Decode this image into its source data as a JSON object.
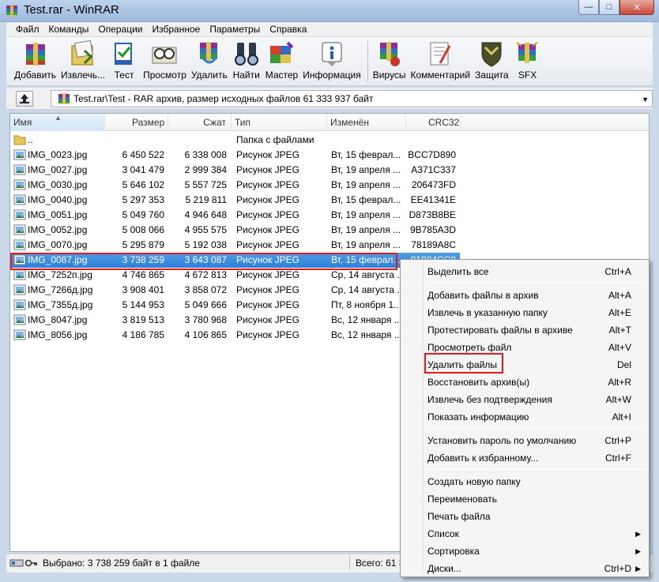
{
  "window": {
    "title": "Test.rar - WinRAR"
  },
  "menu": [
    "Файл",
    "Команды",
    "Операции",
    "Избранное",
    "Параметры",
    "Справка"
  ],
  "toolbar": [
    {
      "label": "Добавить",
      "icon": "add-archive-icon"
    },
    {
      "label": "Извлечь...",
      "icon": "extract-icon"
    },
    {
      "label": "Тест",
      "icon": "test-icon"
    },
    {
      "label": "Просмотр",
      "icon": "view-icon"
    },
    {
      "label": "Удалить",
      "icon": "delete-icon"
    },
    {
      "label": "Найти",
      "icon": "find-icon"
    },
    {
      "label": "Мастер",
      "icon": "wizard-icon"
    },
    {
      "label": "Информация",
      "icon": "info-icon"
    },
    {
      "label": "Вирусы",
      "icon": "virus-scan-icon"
    },
    {
      "label": "Комментарий",
      "icon": "comment-icon"
    },
    {
      "label": "Защита",
      "icon": "protect-icon"
    },
    {
      "label": "SFX",
      "icon": "sfx-icon"
    }
  ],
  "address": {
    "path": "Test.rar\\Test - RAR архив, размер исходных файлов 61 333 937 байт"
  },
  "columns": [
    "Имя",
    "Размер",
    "Сжат",
    "Тип",
    "Изменён",
    "CRC32"
  ],
  "files": [
    {
      "name": "..",
      "size": "",
      "packed": "",
      "type": "Папка с файлами",
      "modified": "",
      "crc": "",
      "folder": true
    },
    {
      "name": "IMG_0023.jpg",
      "size": "6 450 522",
      "packed": "6 338 008",
      "type": "Рисунок JPEG",
      "modified": "Вт, 15 феврал...",
      "crc": "BCC7D890"
    },
    {
      "name": "IMG_0027.jpg",
      "size": "3 041 479",
      "packed": "2 999 384",
      "type": "Рисунок JPEG",
      "modified": "Вт, 19 апреля ...",
      "crc": "A371C337"
    },
    {
      "name": "IMG_0030.jpg",
      "size": "5 646 102",
      "packed": "5 557 725",
      "type": "Рисунок JPEG",
      "modified": "Вт, 19 апреля ...",
      "crc": "206473FD"
    },
    {
      "name": "IMG_0040.jpg",
      "size": "5 297 353",
      "packed": "5 219 811",
      "type": "Рисунок JPEG",
      "modified": "Вт, 15 феврал...",
      "crc": "EE41341E"
    },
    {
      "name": "IMG_0051.jpg",
      "size": "5 049 760",
      "packed": "4 946 648",
      "type": "Рисунок JPEG",
      "modified": "Вт, 19 апреля ...",
      "crc": "D873B8BE"
    },
    {
      "name": "IMG_0052.jpg",
      "size": "5 008 066",
      "packed": "4 955 575",
      "type": "Рисунок JPEG",
      "modified": "Вт, 19 апреля ...",
      "crc": "9B785A3D"
    },
    {
      "name": "IMG_0070.jpg",
      "size": "5 295 879",
      "packed": "5 192 038",
      "type": "Рисунок JPEG",
      "modified": "Вт, 19 апреля ...",
      "crc": "78189A8C"
    },
    {
      "name": "IMG_0087.jpg",
      "size": "3 738 259",
      "packed": "3 643 087",
      "type": "Рисунок JPEG",
      "modified": "Вт, 15 феврал...",
      "crc": "81884CC8",
      "selected": true
    },
    {
      "name": "IMG_7252п.jpg",
      "size": "4 746 865",
      "packed": "4 672 813",
      "type": "Рисунок JPEG",
      "modified": "Ср, 14 августа ...",
      "crc": ""
    },
    {
      "name": "IMG_7266д.jpg",
      "size": "3 908 401",
      "packed": "3 858 072",
      "type": "Рисунок JPEG",
      "modified": "Ср, 14 августа ...",
      "crc": ""
    },
    {
      "name": "IMG_7355д.jpg",
      "size": "5 144 953",
      "packed": "5 049 666",
      "type": "Рисунок JPEG",
      "modified": "Пт, 8 ноября 1...",
      "crc": ""
    },
    {
      "name": "IMG_8047.jpg",
      "size": "3 819 513",
      "packed": "3 780 968",
      "type": "Рисунок JPEG",
      "modified": "Вс, 12 января ...",
      "crc": ""
    },
    {
      "name": "IMG_8056.jpg",
      "size": "4 186 785",
      "packed": "4 106 865",
      "type": "Рисунок JPEG",
      "modified": "Вс, 12 января ...",
      "crc": ""
    }
  ],
  "status": {
    "selected": "Выбрано: 3 738 259 байт в 1 файле",
    "total": "Всего: 61 33"
  },
  "context_menu": [
    {
      "label": "Выделить все",
      "key": "Ctrl+A"
    },
    {
      "sep": true
    },
    {
      "label": "Добавить файлы в архив",
      "key": "Alt+A"
    },
    {
      "label": "Извлечь в указанную папку",
      "key": "Alt+E"
    },
    {
      "label": "Протестировать файлы в архиве",
      "key": "Alt+T"
    },
    {
      "label": "Просмотреть файл",
      "key": "Alt+V"
    },
    {
      "label": "Удалить файлы",
      "key": "Del",
      "highlight": true
    },
    {
      "label": "Восстановить архив(ы)",
      "key": "Alt+R"
    },
    {
      "label": "Извлечь без подтверждения",
      "key": "Alt+W"
    },
    {
      "label": "Показать информацию",
      "key": "Alt+I"
    },
    {
      "sep": true
    },
    {
      "label": "Установить пароль по умолчанию",
      "key": "Ctrl+P"
    },
    {
      "label": "Добавить к избранному...",
      "key": "Ctrl+F"
    },
    {
      "sep": true
    },
    {
      "label": "Создать новую папку",
      "key": ""
    },
    {
      "label": "Переименовать",
      "key": ""
    },
    {
      "label": "Печать файла",
      "key": ""
    },
    {
      "label": "Список",
      "key": "",
      "submenu": true
    },
    {
      "label": "Сортировка",
      "key": "",
      "submenu": true
    },
    {
      "label": "Диски...",
      "key": "Ctrl+D",
      "submenu": true
    }
  ],
  "colors": {
    "selection": "#3385dc",
    "highlight_box": "#e01b1b",
    "title_bar": "#a9c3e2"
  }
}
